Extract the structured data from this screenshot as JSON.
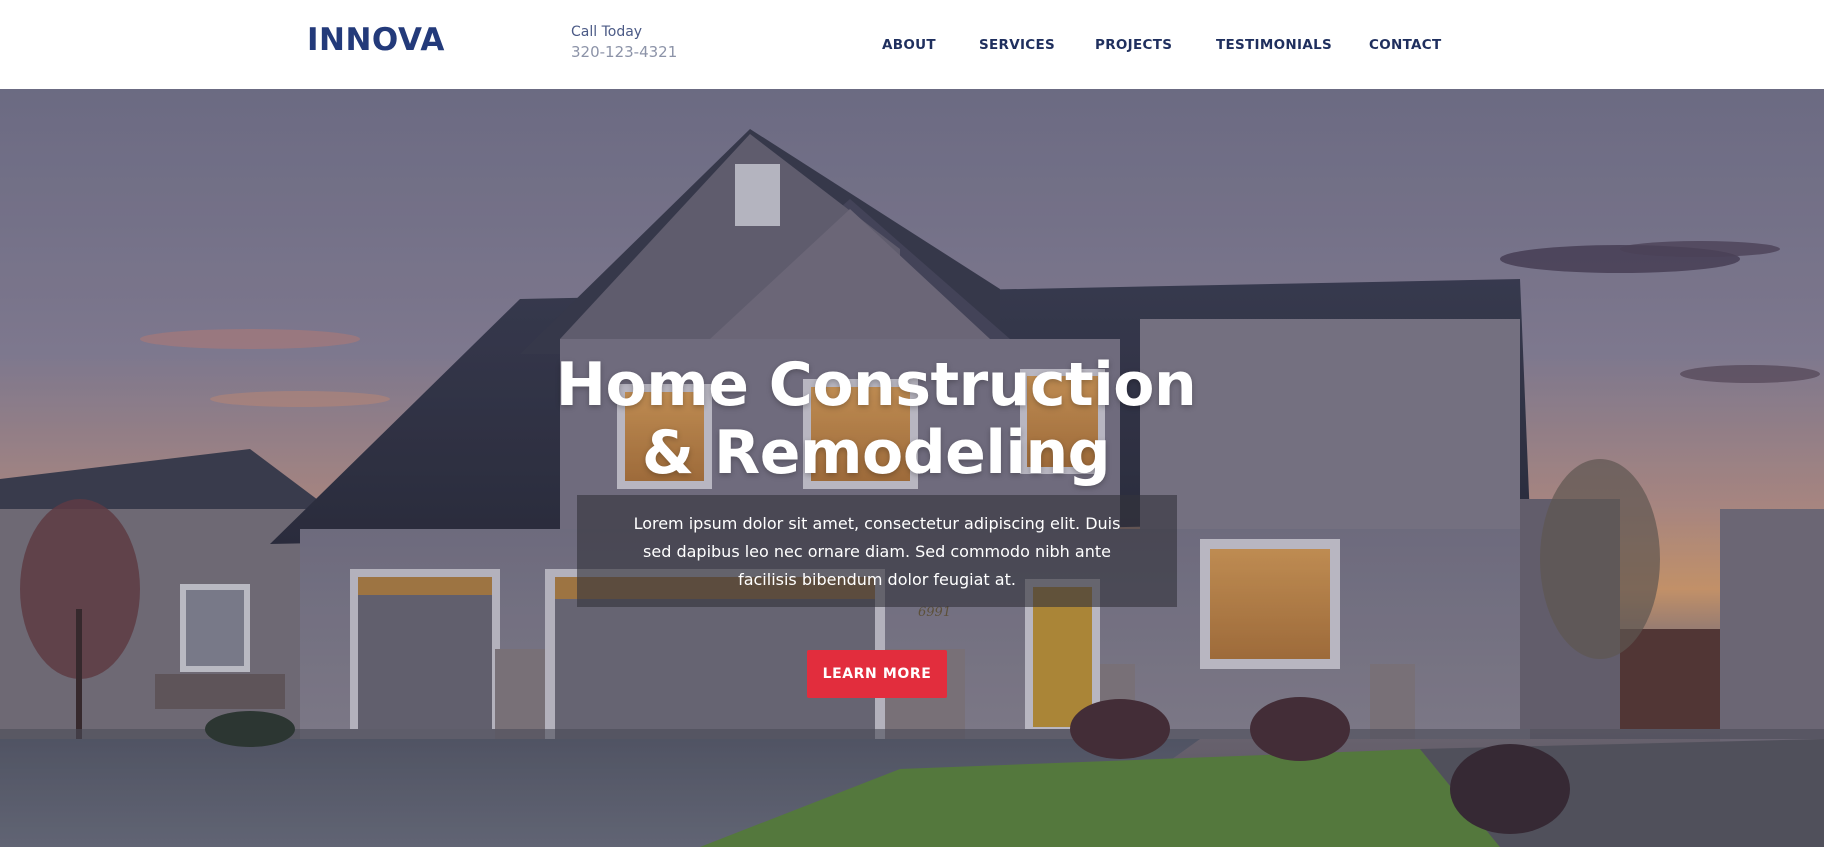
{
  "brand": {
    "logo": "INNOVA",
    "accent": "#e22d3d",
    "primary": "#233a7a"
  },
  "header": {
    "call_label": "Call Today",
    "call_number": "320-123-4321",
    "nav": [
      {
        "label": "ABOUT"
      },
      {
        "label": "SERVICES"
      },
      {
        "label": "PROJECTS"
      },
      {
        "label": "TESTIMONIALS"
      },
      {
        "label": "CONTACT"
      }
    ]
  },
  "hero": {
    "headline_line1": "Home Construction",
    "headline_line2": "& Remodeling",
    "description": "Lorem ipsum dolor sit amet, consectetur adipiscing elit. Duis sed dapibus leo nec ornare diam. Sed commodo nibh ante facilisis bibendum dolor feugiat at.",
    "cta_label": "LEARN MORE",
    "house_number": "6991",
    "background": "house-at-dusk-photo"
  }
}
